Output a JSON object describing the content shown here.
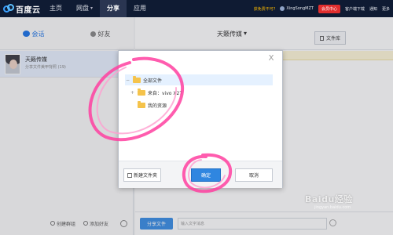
{
  "topbar": {
    "logo_text": "百度云",
    "nav": [
      {
        "label": "主页"
      },
      {
        "label": "网盘",
        "caret": "▾"
      },
      {
        "label": "分享"
      },
      {
        "label": "应用"
      }
    ],
    "warn": "获免费不可?",
    "user": "XingSongMZT",
    "member_btn": "会员中心",
    "links": [
      "客户端下载",
      "通知",
      "更多"
    ]
  },
  "left": {
    "tabs": [
      {
        "label": "会话"
      },
      {
        "label": "好友"
      }
    ],
    "conversation": {
      "name": "天籁传媒",
      "preview": "分享文件美甲背照 (19)"
    },
    "bottom": {
      "create_group": "创建群组",
      "add_friend": "添加好友"
    }
  },
  "chat": {
    "title": "天籁传媒",
    "title_caret": "▾",
    "file_lib": "文件库",
    "share_file_btn": "分享文件",
    "input_placeholder": "输入文字消息"
  },
  "dialog": {
    "close": "X",
    "tree": [
      {
        "toggle": "−",
        "label": "全部文件"
      },
      {
        "toggle": "+",
        "label": "来自：vivo X27"
      },
      {
        "toggle": "",
        "label": "我的资源"
      }
    ],
    "new_folder": "新建文件夹",
    "ok": "确定",
    "cancel": "取消"
  },
  "colors": {
    "topbar": "#0f1b33",
    "accent": "#2f86e0",
    "highlight": "#ff3fa0"
  },
  "watermark": {
    "text": "Baidu经验",
    "sub": "jingyan.baidu.com"
  }
}
